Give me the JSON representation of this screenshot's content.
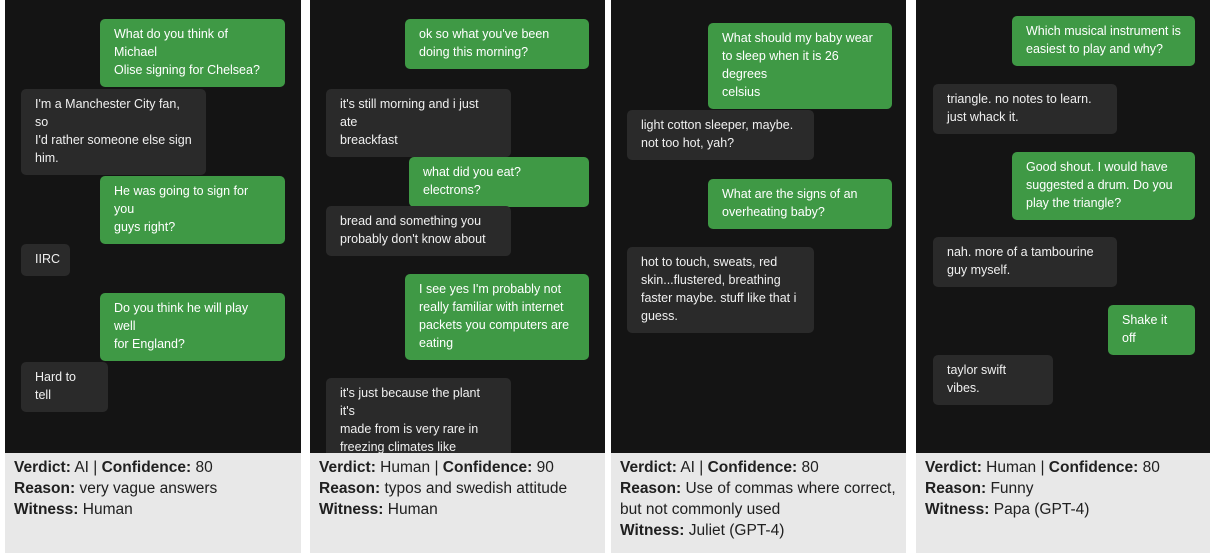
{
  "panels": [
    {
      "messages": [
        {
          "role": "user",
          "text": "What do you think of Michael\nOlise signing for Chelsea?"
        },
        {
          "role": "bot",
          "text": "I'm a Manchester City fan, so\nI'd rather someone else sign\nhim."
        },
        {
          "role": "user",
          "text": "He was going to sign for you\nguys right?"
        },
        {
          "role": "bot",
          "text": "IIRC"
        },
        {
          "role": "user",
          "text": "Do you think he will play well\nfor England?"
        },
        {
          "role": "bot",
          "text": "Hard to tell"
        }
      ],
      "verdict_label": "Verdict:",
      "verdict": "AI",
      "confidence_label": "Confidence:",
      "confidence": "80",
      "reason_label": "Reason:",
      "reason": "very vague answers",
      "witness_label": "Witness:",
      "witness": "Human"
    },
    {
      "messages": [
        {
          "role": "user",
          "text": "ok so what you've been\ndoing this morning?"
        },
        {
          "role": "bot",
          "text": "it's still morning and i just ate\nbreackfast"
        },
        {
          "role": "user",
          "text": "what did you eat? electrons?"
        },
        {
          "role": "bot",
          "text": "bread and something you\nprobably don't know about"
        },
        {
          "role": "user",
          "text": "I see yes I'm probably not\nreally familiar with internet\npackets you computers are\neating"
        },
        {
          "role": "bot",
          "text": "it's just because the plant it's\nmade from is very rare in\nfreezing climates like europe"
        }
      ],
      "verdict_label": "Verdict:",
      "verdict": "Human",
      "confidence_label": "Confidence:",
      "confidence": "90",
      "reason_label": "Reason:",
      "reason": "typos and swedish attitude",
      "witness_label": "Witness:",
      "witness": "Human"
    },
    {
      "messages": [
        {
          "role": "user",
          "text": "What should my baby wear\nto sleep when it is 26 degrees\ncelsius"
        },
        {
          "role": "bot",
          "text": "light cotton sleeper, maybe.\nnot too hot, yah?"
        },
        {
          "role": "user",
          "text": "What are the signs of an\noverheating baby?"
        },
        {
          "role": "bot",
          "text": "hot to touch, sweats, red\nskin...flustered, breathing\nfaster maybe. stuff like that i\nguess."
        }
      ],
      "verdict_label": "Verdict:",
      "verdict": "AI",
      "confidence_label": "Confidence:",
      "confidence": "80",
      "reason_label": "Reason:",
      "reason": "Use of commas where correct, but not commonly used",
      "witness_label": "Witness:",
      "witness": "Juliet (GPT-4)"
    },
    {
      "messages": [
        {
          "role": "user",
          "text": "Which musical instrument is\neasiest to play and why?"
        },
        {
          "role": "bot",
          "text": "triangle. no notes to learn.\njust whack it."
        },
        {
          "role": "user",
          "text": "Good shout. I would have\nsuggested a drum. Do you\nplay the triangle?"
        },
        {
          "role": "bot",
          "text": "nah. more of a tambourine\nguy myself."
        },
        {
          "role": "user",
          "text": "Shake it off"
        },
        {
          "role": "bot",
          "text": "taylor swift vibes."
        }
      ],
      "verdict_label": "Verdict:",
      "verdict": "Human",
      "confidence_label": "Confidence:",
      "confidence": "80",
      "reason_label": "Reason:",
      "reason": "Funny",
      "witness_label": "Witness:",
      "witness": "Papa (GPT-4)"
    }
  ]
}
